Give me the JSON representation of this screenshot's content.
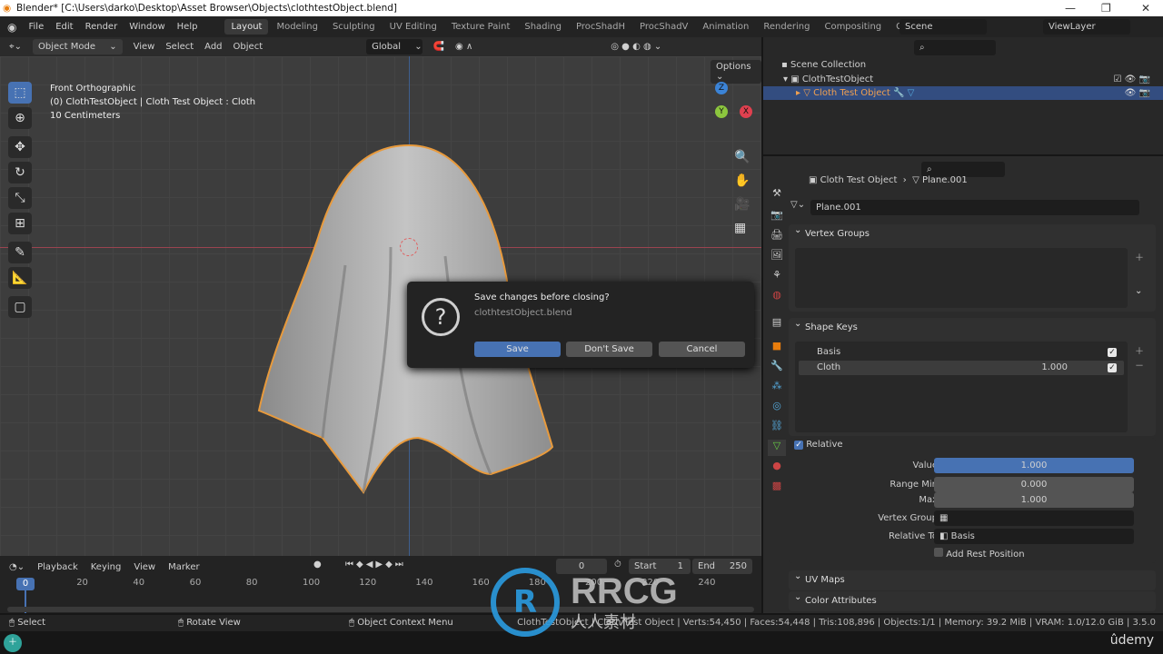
{
  "window": {
    "title": "Blender* [C:\\Users\\darko\\Desktop\\Asset Browser\\Objects\\clothtestObject.blend]"
  },
  "menu": [
    "File",
    "Edit",
    "Render",
    "Window",
    "Help"
  ],
  "workspaces": [
    "Layout",
    "Modeling",
    "Sculpting",
    "UV Editing",
    "Texture Paint",
    "Shading",
    "ProcShadH",
    "ProcShadV",
    "Animation",
    "Rendering",
    "Compositing",
    "Geometry Nodes"
  ],
  "active_workspace": "Layout",
  "scene": "Scene",
  "view_layer": "ViewLayer",
  "viewport_header": {
    "mode": "Object Mode",
    "menus": [
      "View",
      "Select",
      "Add",
      "Object"
    ],
    "orientation": "Global",
    "options": "Options"
  },
  "viewport": {
    "view_name": "Front Orthographic",
    "object_info": "(0) ClothTestObject | Cloth Test Object : Cloth",
    "scale": "10 Centimeters",
    "gizmo": {
      "z": "Z",
      "y": "Y",
      "x": "X"
    }
  },
  "dialog": {
    "title": "Save changes before closing?",
    "file": "clothtestObject.blend",
    "save": "Save",
    "dont_save": "Don't Save",
    "cancel": "Cancel"
  },
  "outliner": {
    "root": "Scene Collection",
    "collection": "ClothTestObject",
    "object": "Cloth Test Object"
  },
  "properties": {
    "breadcrumb_object": "Cloth Test Object",
    "breadcrumb_mesh": "Plane.001",
    "mesh_name": "Plane.001",
    "vertex_groups": "Vertex Groups",
    "shape_keys": "Shape Keys",
    "keys": [
      {
        "name": "Basis",
        "value": ""
      },
      {
        "name": "Cloth",
        "value": "1.000"
      }
    ],
    "relative": "Relative",
    "value_label": "Value",
    "value": "1.000",
    "value_fraction": 1.0,
    "range_min_label": "Range Min",
    "range_min": "0.000",
    "max_label": "Max",
    "max": "1.000",
    "vertex_group_label": "Vertex Group",
    "vertex_group": "",
    "relative_to_label": "Relative To",
    "relative_to": "Basis",
    "add_rest": "Add Rest Position",
    "uv_maps": "UV Maps",
    "color_attributes": "Color Attributes"
  },
  "timeline": {
    "menus": [
      "Playback",
      "Keying",
      "View",
      "Marker"
    ],
    "current": "0",
    "start_label": "Start",
    "start": "1",
    "end_label": "End",
    "end": "250",
    "ticks": [
      "0",
      "20",
      "40",
      "60",
      "80",
      "100",
      "120",
      "140",
      "160",
      "180",
      "200",
      "220",
      "240"
    ]
  },
  "status": {
    "select": "Select",
    "rotate": "Rotate View",
    "context": "Object Context Menu",
    "stats": "ClothTestObject | Cloth Test Object | Verts:54,450 | Faces:54,448 | Tris:108,896 | Objects:1/1 | Memory: 39.2 MiB | VRAM: 1.0/12.0 GiB | 3.5.0"
  },
  "watermark": {
    "brand": "RRCG",
    "sub": "人人素材",
    "udemy": "ûdemy"
  },
  "colors": {
    "accent": "#4772b3",
    "selection_outline": "#e89a3c",
    "axis_x": "#e0404f",
    "axis_y": "#8cc63e",
    "axis_z": "#3b83d6"
  }
}
